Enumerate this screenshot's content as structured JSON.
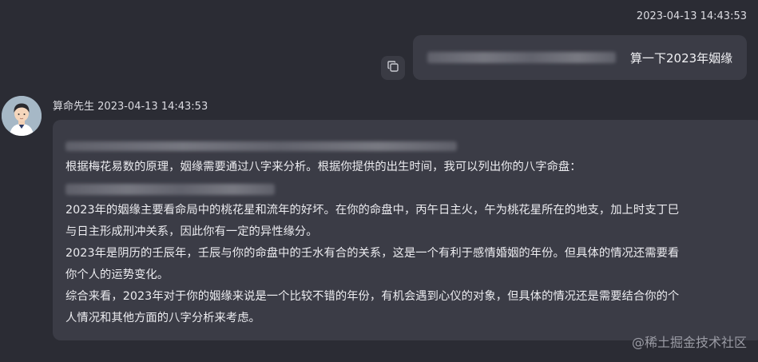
{
  "user_message": {
    "timestamp": "2023-04-13 14:43:53",
    "text": "算一下2023年姻缘",
    "copy_icon": "copy-icon",
    "redacted_prefix": "blurred text"
  },
  "bot_message": {
    "sender": "算命先生",
    "timestamp": "2023-04-13 14:43:53",
    "avatar_icon": "avatar-icon",
    "lines": [
      "根据梅花易数的原理，姻缘需要通过八字来分析。根据你提供的出生时间，我可以列出你的八字命盘：",
      "2023年的姻缘主要看命局中的桃花星和流年的好坏。在你的命盘中，丙午日主火，午为桃花星所在的地支，加上时支丁巳",
      "与日主形成刑冲关系，因此你有一定的异性缘分。",
      "2023年是阴历的壬辰年，壬辰与你的命盘中的壬水有合的关系，这是一个有利于感情婚姻的年份。但具体的情况还需要看",
      "你个人的运势变化。",
      "综合来看，2023年对于你的姻缘来说是一个比较不错的年份，有机会遇到心仪的对象，但具体的情况还是需要结合你的个",
      "人情况和其他方面的八字分析来考虑。"
    ]
  },
  "watermark": "@稀土掘金技术社区"
}
